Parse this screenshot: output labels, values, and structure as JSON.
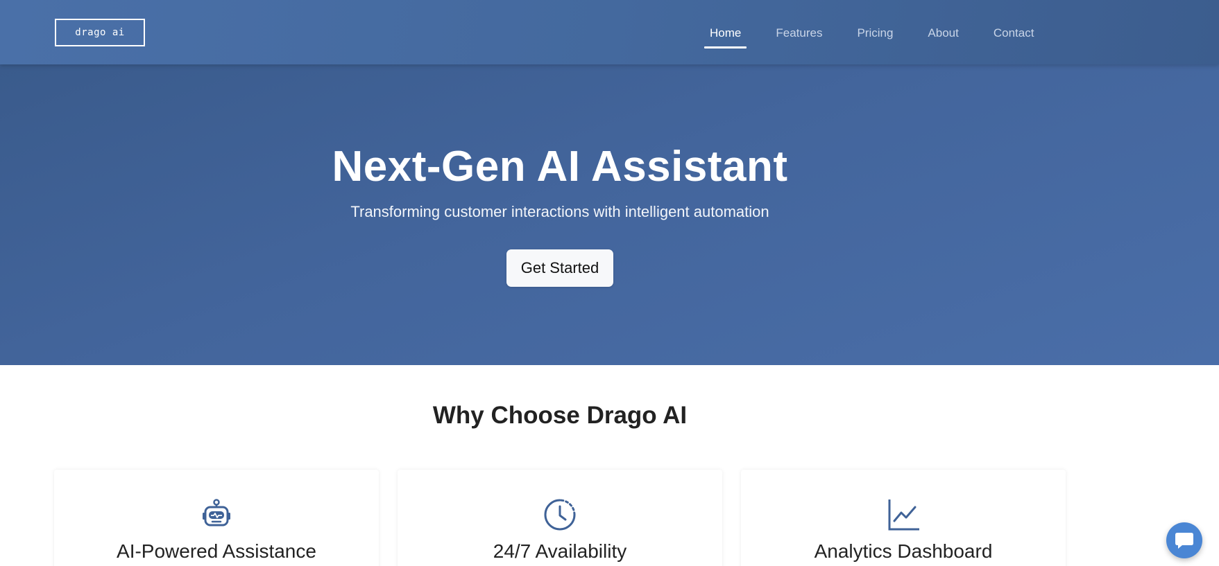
{
  "header": {
    "logo_text": "drago ai",
    "nav": [
      {
        "label": "Home",
        "active": true
      },
      {
        "label": "Features",
        "active": false
      },
      {
        "label": "Pricing",
        "active": false
      },
      {
        "label": "About",
        "active": false
      },
      {
        "label": "Contact",
        "active": false
      }
    ]
  },
  "hero": {
    "title": "Next-Gen AI Assistant",
    "subtitle": "Transforming customer interactions with intelligent automation",
    "cta_label": "Get Started"
  },
  "features": {
    "title": "Why Choose Drago AI",
    "cards": [
      {
        "title": "AI-Powered Assistance",
        "icon": "robot-icon"
      },
      {
        "title": "24/7 Availability",
        "icon": "clock-icon"
      },
      {
        "title": "Analytics Dashboard",
        "icon": "chart-line-icon"
      }
    ]
  },
  "chat_widget": {
    "icon": "chat-bubble-icon"
  },
  "colors": {
    "header_bg": "#44699e",
    "hero_bg": "#43659c",
    "icon_accent": "#3f6297",
    "chat_button": "#4a86d4",
    "cta_bg": "#f7f8fa"
  }
}
